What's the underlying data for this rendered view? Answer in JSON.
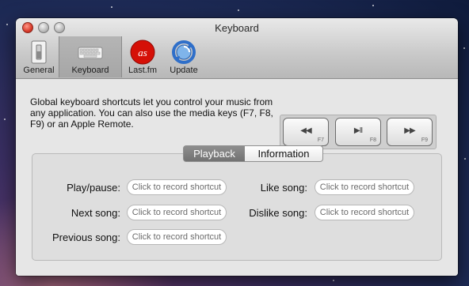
{
  "window": {
    "title": "Keyboard"
  },
  "toolbar": {
    "items": [
      {
        "label": "General",
        "icon": "switch-icon"
      },
      {
        "label": "Keyboard",
        "icon": "keyboard-icon",
        "selected": true
      },
      {
        "label": "Last.fm",
        "icon": "lastfm-icon"
      },
      {
        "label": "Update",
        "icon": "update-icon"
      }
    ]
  },
  "description": "Global keyboard shortcuts let you control your music from any application. You can also use the media keys (F7, F8, F9) or an Apple Remote.",
  "media_keys": [
    {
      "glyph": "◀◀",
      "fn": "F7"
    },
    {
      "glyph": "▶II",
      "fn": "F8"
    },
    {
      "glyph": "▶▶",
      "fn": "F9"
    }
  ],
  "tabs": [
    {
      "label": "Playback",
      "selected": true
    },
    {
      "label": "Information",
      "selected": false
    }
  ],
  "shortcuts": {
    "placeholder": "Click to record shortcut",
    "play_pause": "Play/pause:",
    "next_song": "Next song:",
    "previous_song": "Previous song:",
    "like_song": "Like song:",
    "dislike_song": "Dislike song:"
  },
  "colors": {
    "lastfm_red": "#d51007",
    "selected_tab": "#7d7d7d",
    "update_blue": "#2f6fc9"
  }
}
